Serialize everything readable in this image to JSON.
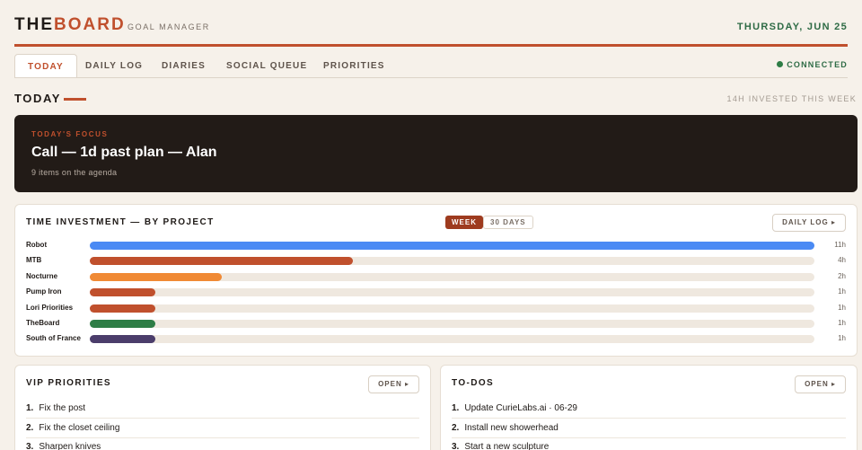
{
  "header": {
    "brand_part1": "THE",
    "brand_part2": "BOARD",
    "subtitle": "GOAL MANAGER",
    "date": "THURSDAY, JUN 25"
  },
  "tabs": [
    {
      "label": "TODAY",
      "active": true
    },
    {
      "label": "DAILY LOG",
      "active": false
    },
    {
      "label": "DIARIES",
      "active": false
    },
    {
      "label": "SOCIAL QUEUE",
      "active": false
    },
    {
      "label": "PRIORITIES",
      "active": false
    }
  ],
  "status": {
    "label": "CONNECTED",
    "color": "#2e7d46"
  },
  "today": {
    "title": "TODAY",
    "invested": "14H INVESTED THIS WEEK"
  },
  "focus": {
    "kicker": "TODAY'S FOCUS",
    "headline": "Call — 1d past plan — Alan",
    "count": "9 items on the agenda"
  },
  "time_investment": {
    "title": "TIME INVESTMENT — BY PROJECT",
    "toggle_week": "WEEK",
    "toggle_30": "30 DAYS",
    "button": "DAILY LOG ▸",
    "max_hours": 11,
    "projects": [
      {
        "name": "Robot",
        "hours": 11,
        "label": "11h",
        "color": "#4a8af4"
      },
      {
        "name": "MTB",
        "hours": 4,
        "label": "4h",
        "color": "#c0502d"
      },
      {
        "name": "Nocturne",
        "hours": 2,
        "label": "2h",
        "color": "#f08a35"
      },
      {
        "name": "Pump Iron",
        "hours": 1,
        "label": "1h",
        "color": "#c0502d"
      },
      {
        "name": "Lori Priorities",
        "hours": 1,
        "label": "1h",
        "color": "#c0502d"
      },
      {
        "name": "TheBoard",
        "hours": 1,
        "label": "1h",
        "color": "#2e7d46"
      },
      {
        "name": "South of France",
        "hours": 1,
        "label": "1h",
        "color": "#4b3d6b"
      }
    ]
  },
  "vip": {
    "title": "VIP PRIORITIES",
    "button": "OPEN ▸",
    "items": [
      {
        "num": "1.",
        "text": "Fix the post"
      },
      {
        "num": "2.",
        "text": "Fix the closet ceiling"
      },
      {
        "num": "3.",
        "text": "Sharpen knives"
      }
    ]
  },
  "todos": {
    "title": "TO-DOS",
    "button": "OPEN ▸",
    "items": [
      {
        "num": "1.",
        "text": "Update CurieLabs.ai · 06-29"
      },
      {
        "num": "2.",
        "text": "Install new showerhead"
      },
      {
        "num": "3.",
        "text": "Start a new sculpture"
      }
    ]
  }
}
